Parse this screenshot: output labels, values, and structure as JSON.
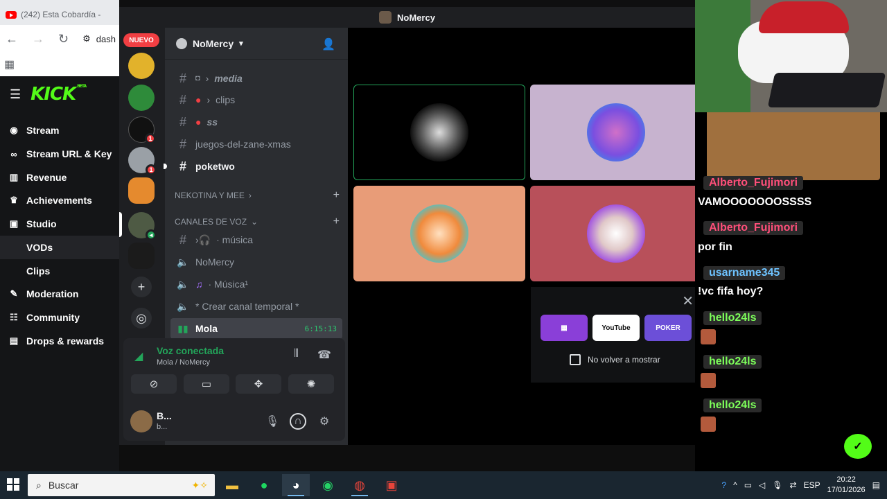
{
  "browser": {
    "tab_title": "(242) Esta Cobardía -",
    "url_partial": "dash"
  },
  "kick": {
    "logo": "KICK",
    "beta": "BETA",
    "nav": [
      {
        "label": "Stream",
        "icon": "radio-icon"
      },
      {
        "label": "Stream URL & Key",
        "icon": "link-icon"
      },
      {
        "label": "Revenue",
        "icon": "chart-icon"
      },
      {
        "label": "Achievements",
        "icon": "trophy-icon"
      },
      {
        "label": "Studio",
        "icon": "studio-icon"
      },
      {
        "label": "VODs",
        "icon": ""
      },
      {
        "label": "Clips",
        "icon": ""
      },
      {
        "label": "Moderation",
        "icon": "wrench-icon"
      },
      {
        "label": "Community",
        "icon": "community-icon"
      },
      {
        "label": "Drops & rewards",
        "icon": "gift-icon"
      }
    ]
  },
  "discord": {
    "window_title": "NoMercy",
    "nuevo_badge": "NUEVO",
    "server_name": "NoMercy",
    "badge_count": "1",
    "channels": [
      {
        "name": "media",
        "prefix": "› "
      },
      {
        "name": "clips",
        "prefix": "› "
      },
      {
        "name": "ss",
        "prefix": ""
      },
      {
        "name": "juegos-del-zane-xmas",
        "prefix": ""
      },
      {
        "name": "poketwo",
        "prefix": ""
      }
    ],
    "categories": [
      "NEKOTINA Y MEE",
      "CANALES DE VOZ"
    ],
    "voice_channels": [
      "· música",
      "NoMercy",
      "· Música¹",
      "* Crear canal temporal *",
      "Mola"
    ],
    "mola_timer": "6:15:13",
    "voice": {
      "status": "Voz conectada",
      "channel": "Mola / NoMercy"
    },
    "user": {
      "name": "B...",
      "tag": "b..."
    },
    "activities": [
      "",
      "YouTube",
      "POKER"
    ],
    "dont_show": "No volver a mostrar"
  },
  "chat": {
    "messages": [
      {
        "user": "Alberto_Fujimori",
        "color": "#ff4f7a",
        "text": "VAMOOOOOOOSSSS"
      },
      {
        "user": "Alberto_Fujimori",
        "color": "#ff4f7a",
        "text": "por fin"
      },
      {
        "user": "usarname345",
        "color": "#6ec3ff",
        "text": "!vc fifa hoy?"
      },
      {
        "user": "hello24ls",
        "color": "#7dff5a",
        "text": ""
      },
      {
        "user": "hello24ls",
        "color": "#7dff5a",
        "text": ""
      },
      {
        "user": "hello24ls",
        "color": "#7dff5a",
        "text": ""
      }
    ]
  },
  "taskbar": {
    "search": "Buscar",
    "lang": "ESP",
    "time": "20:22",
    "date": "17/01/2026",
    "notif_count": "1"
  }
}
